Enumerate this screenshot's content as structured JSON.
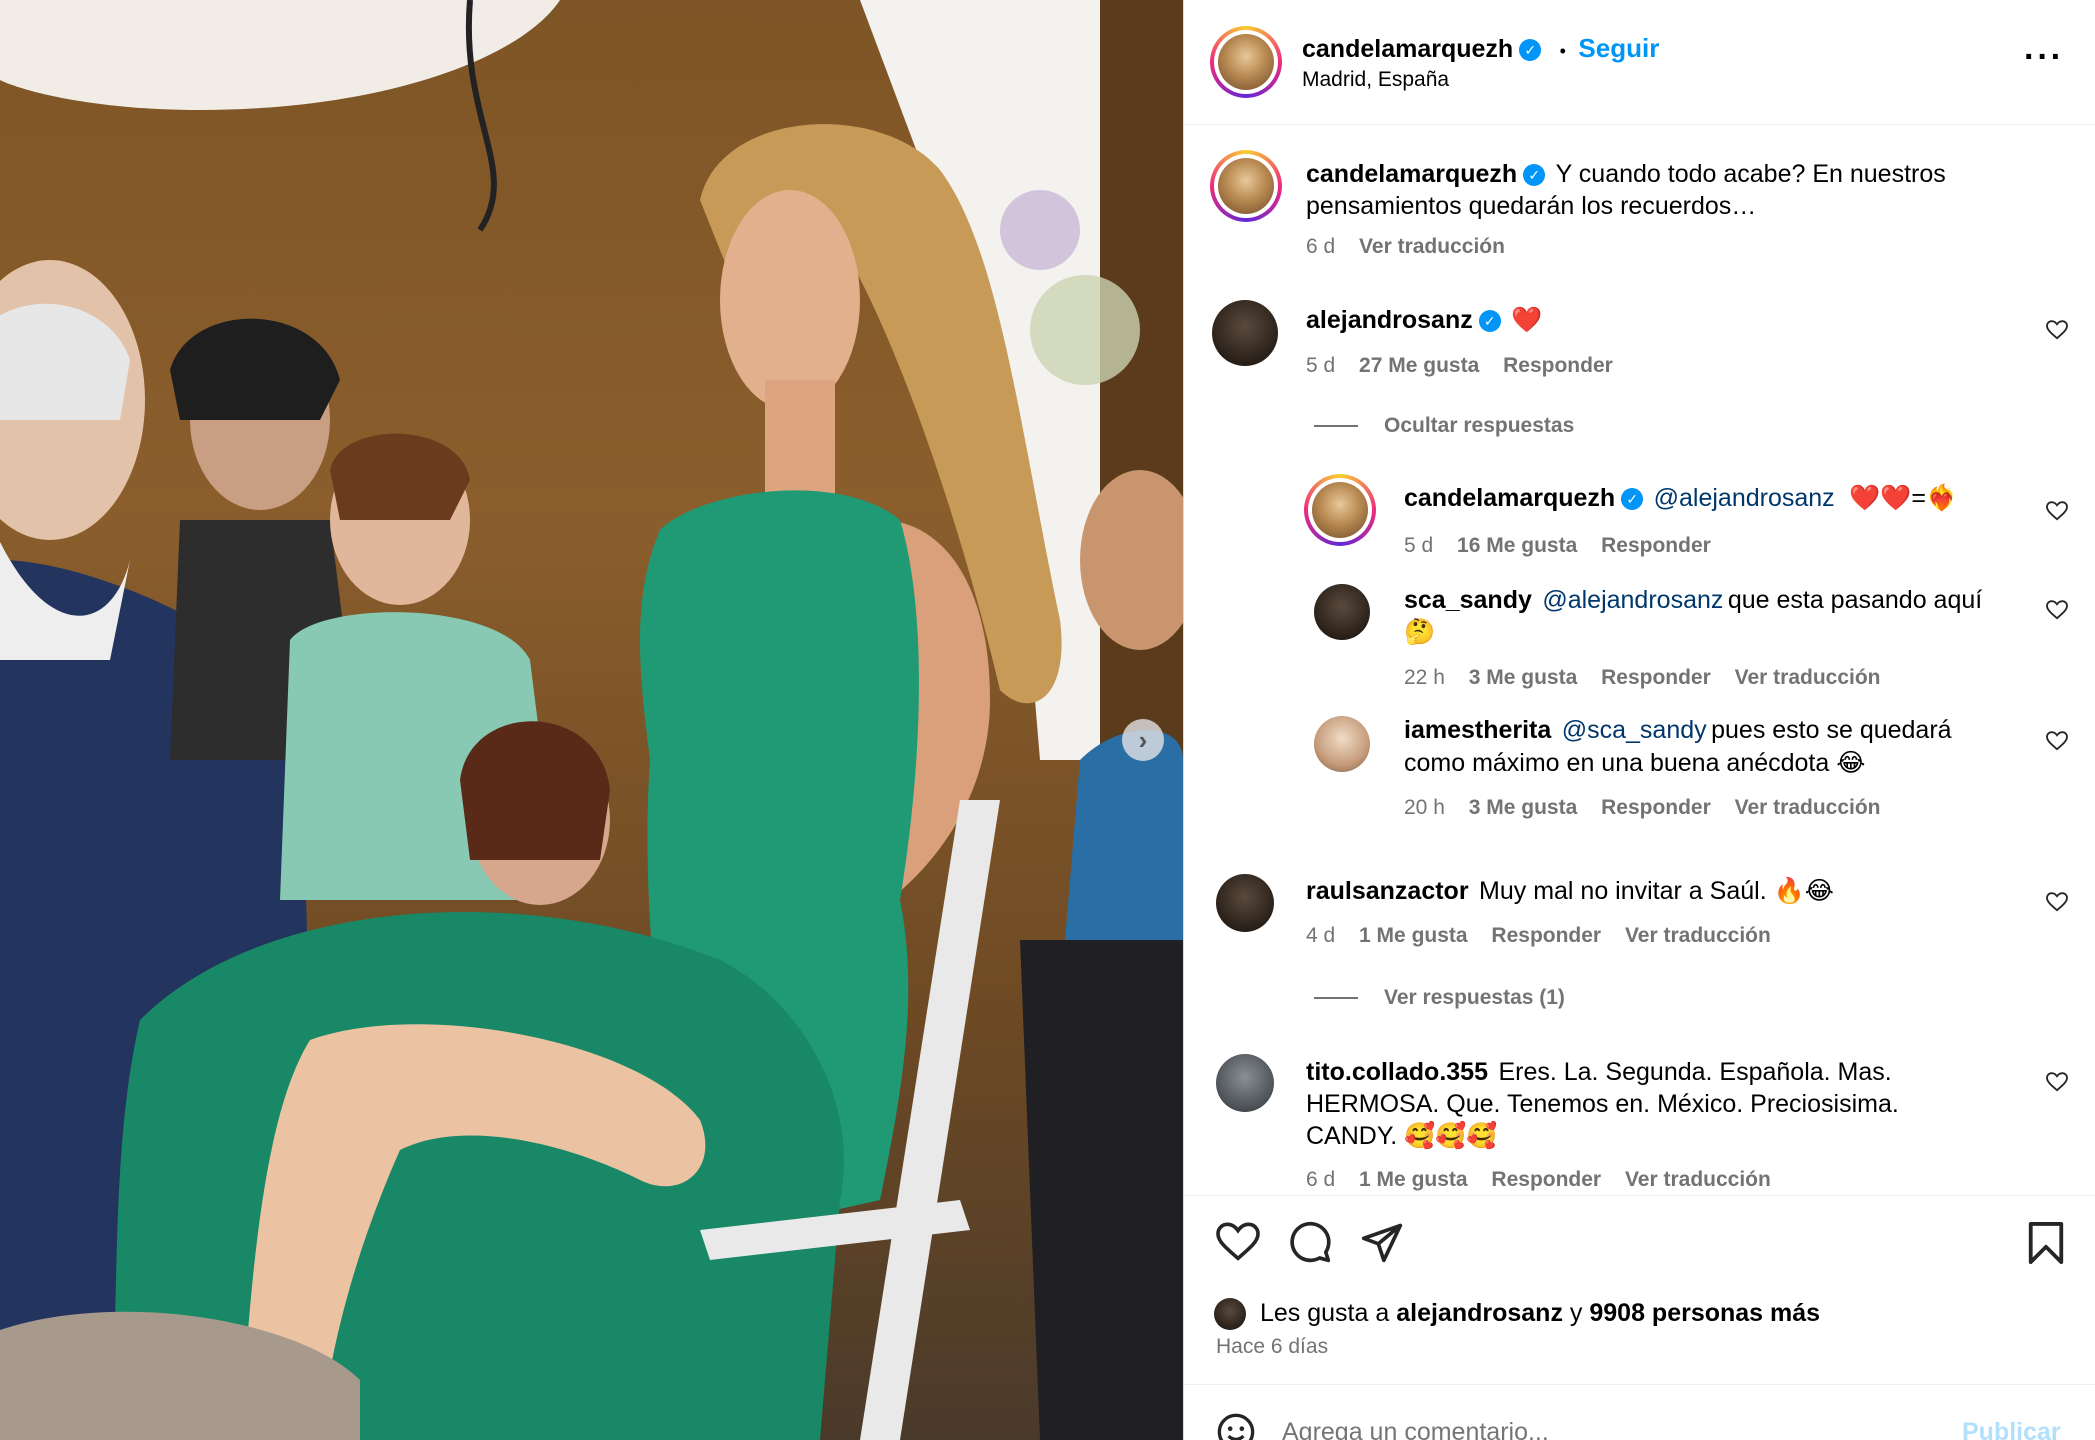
{
  "post": {
    "author": "candelamarquezh",
    "follow_label": "Seguir",
    "dot": "•",
    "location": "Madrid, España",
    "more_icon": "more-horizontal-icon"
  },
  "caption": {
    "author": "candelamarquezh",
    "text_line1": "Y cuando todo acabe? En nuestros",
    "text_line2": "pensamientos quedarán los recuerdos…",
    "time": "6 d",
    "translate": "Ver traducción"
  },
  "comments": [
    {
      "user": "alejandrosanz",
      "verified": true,
      "text": "❤️",
      "time": "5 d",
      "likes": "27 Me gusta",
      "reply": "Responder",
      "hide_replies": "Ocultar respuestas",
      "replies": [
        {
          "user": "candelamarquezh",
          "verified": true,
          "mention": "@alejandrosanz",
          "text": "❤️❤️=❤️‍🔥",
          "time": "5 d",
          "likes": "16 Me gusta",
          "reply": "Responder"
        },
        {
          "user": "sca_sandy",
          "mention": "@alejandrosanz",
          "text_line1": "que esta pasando aquí",
          "text_line2": "🤔",
          "time": "22 h",
          "likes": "3 Me gusta",
          "reply": "Responder",
          "translate": "Ver traducción"
        },
        {
          "user": "iamestherita",
          "mention": "@sca_sandy",
          "text_line1": "pues esto se quedará",
          "text_line2": "como máximo en una buena anécdota 😂",
          "time": "20 h",
          "likes": "3 Me gusta",
          "reply": "Responder",
          "translate": "Ver traducción"
        }
      ]
    },
    {
      "user": "raulsanzactor",
      "text": "Muy mal no invitar a Saúl. 🔥😂",
      "time": "4 d",
      "likes": "1 Me gusta",
      "reply": "Responder",
      "translate": "Ver traducción",
      "view_replies": "Ver respuestas (1)"
    },
    {
      "user": "tito.collado.355",
      "text_line1": "Eres. La. Segunda. Española. Mas.",
      "text_line2": "HERMOSA. Que. Tenemos en. México. Preciosisima.",
      "text_line3": "CANDY. 🥰🥰🥰",
      "time": "6 d",
      "likes": "1 Me gusta",
      "reply": "Responder",
      "translate": "Ver traducción"
    }
  ],
  "actions": {
    "like_icon": "heart-icon",
    "comment_icon": "comment-icon",
    "share_icon": "send-icon",
    "save_icon": "bookmark-icon"
  },
  "likes": {
    "prefix": "Les gusta a",
    "user": "alejandrosanz",
    "and": "y",
    "others": "9908 personas más",
    "date": "Hace 6 días"
  },
  "composer": {
    "emoji_icon": "emoji-icon",
    "placeholder": "Agrega un comentario...",
    "publish": "Publicar"
  },
  "colors": {
    "accent": "#0095f6",
    "secondary_text": "#737373",
    "mention": "#00376b",
    "dress_green": "#1f9a74"
  }
}
